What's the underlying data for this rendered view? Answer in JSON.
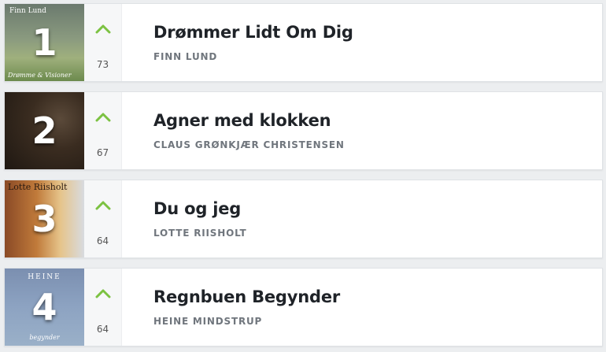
{
  "chart_list": [
    {
      "rank": "1",
      "title": "Drømmer Lidt Om Dig",
      "artist": "FINN LUND",
      "count": "73",
      "cover_top": "Finn Lund",
      "cover_bottom": "Drømme & Visioner"
    },
    {
      "rank": "2",
      "title": "Agner med klokken",
      "artist": "CLAUS GRØNKJÆR CHRISTENSEN",
      "count": "67",
      "cover_top": "",
      "cover_bottom": ""
    },
    {
      "rank": "3",
      "title": "Du og jeg",
      "artist": "LOTTE RIISHOLT",
      "count": "64",
      "cover_top": "Lotte Riisholt",
      "cover_bottom": ""
    },
    {
      "rank": "4",
      "title": "Regnbuen Begynder",
      "artist": "HEINE MINDSTRUP",
      "count": "64",
      "cover_top": "HEINE",
      "cover_bottom": "begynder"
    }
  ],
  "trend_icon": "chevron-up-icon",
  "colors": {
    "trend_up": "#7cc242",
    "title": "#1f2328",
    "artist": "#70767d"
  }
}
